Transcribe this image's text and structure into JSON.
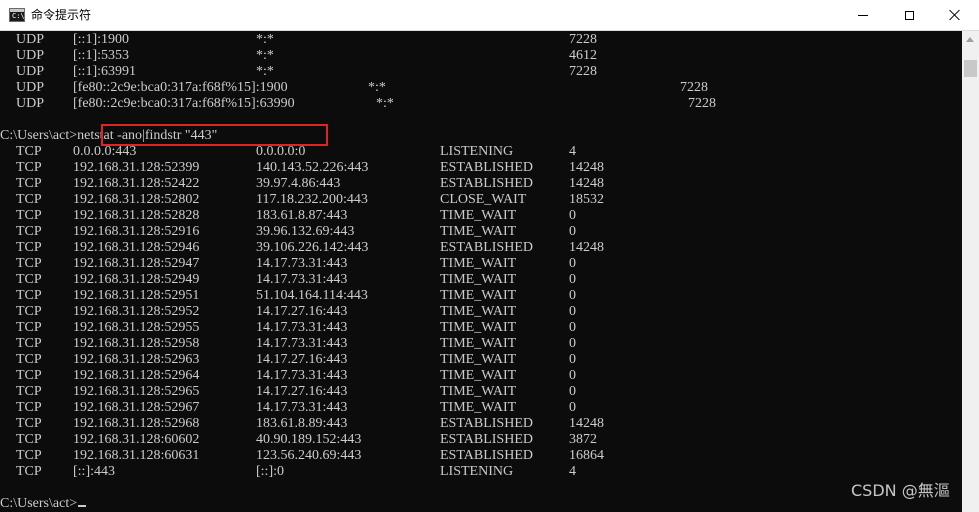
{
  "window": {
    "title": "命令提示符",
    "app_icon_text": "C:\\"
  },
  "top_rows": [
    {
      "proto": "UDP",
      "local": "[::1]:1900",
      "foreign": "*:*",
      "state": "",
      "pid": "7228"
    },
    {
      "proto": "UDP",
      "local": "[::1]:5353",
      "foreign": "*:*",
      "state": "",
      "pid": "4612"
    },
    {
      "proto": "UDP",
      "local": "[::1]:63991",
      "foreign": "*:*",
      "state": "",
      "pid": "7228"
    },
    {
      "proto": "UDP",
      "local": "[fe80::2c9e:bca0:317a:f68f%15]:1900",
      "foreign": "*:*",
      "state": "",
      "pid": "7228"
    },
    {
      "proto": "UDP",
      "local": "[fe80::2c9e:bca0:317a:f68f%15]:63990",
      "foreign": "*:*",
      "state": "",
      "pid": "7228"
    }
  ],
  "command": {
    "prompt": "C:\\Users\\act>",
    "text": "netstat -ano|findstr \"443\""
  },
  "result_rows": [
    {
      "proto": "TCP",
      "local": "0.0.0.0:443",
      "foreign": "0.0.0.0:0",
      "state": "LISTENING",
      "pid": "4"
    },
    {
      "proto": "TCP",
      "local": "192.168.31.128:52399",
      "foreign": "140.143.52.226:443",
      "state": "ESTABLISHED",
      "pid": "14248"
    },
    {
      "proto": "TCP",
      "local": "192.168.31.128:52422",
      "foreign": "39.97.4.86:443",
      "state": "ESTABLISHED",
      "pid": "14248"
    },
    {
      "proto": "TCP",
      "local": "192.168.31.128:52802",
      "foreign": "117.18.232.200:443",
      "state": "CLOSE_WAIT",
      "pid": "18532"
    },
    {
      "proto": "TCP",
      "local": "192.168.31.128:52828",
      "foreign": "183.61.8.87:443",
      "state": "TIME_WAIT",
      "pid": "0"
    },
    {
      "proto": "TCP",
      "local": "192.168.31.128:52916",
      "foreign": "39.96.132.69:443",
      "state": "TIME_WAIT",
      "pid": "0"
    },
    {
      "proto": "TCP",
      "local": "192.168.31.128:52946",
      "foreign": "39.106.226.142:443",
      "state": "ESTABLISHED",
      "pid": "14248"
    },
    {
      "proto": "TCP",
      "local": "192.168.31.128:52947",
      "foreign": "14.17.73.31:443",
      "state": "TIME_WAIT",
      "pid": "0"
    },
    {
      "proto": "TCP",
      "local": "192.168.31.128:52949",
      "foreign": "14.17.73.31:443",
      "state": "TIME_WAIT",
      "pid": "0"
    },
    {
      "proto": "TCP",
      "local": "192.168.31.128:52951",
      "foreign": "51.104.164.114:443",
      "state": "TIME_WAIT",
      "pid": "0"
    },
    {
      "proto": "TCP",
      "local": "192.168.31.128:52952",
      "foreign": "14.17.27.16:443",
      "state": "TIME_WAIT",
      "pid": "0"
    },
    {
      "proto": "TCP",
      "local": "192.168.31.128:52955",
      "foreign": "14.17.73.31:443",
      "state": "TIME_WAIT",
      "pid": "0"
    },
    {
      "proto": "TCP",
      "local": "192.168.31.128:52958",
      "foreign": "14.17.73.31:443",
      "state": "TIME_WAIT",
      "pid": "0"
    },
    {
      "proto": "TCP",
      "local": "192.168.31.128:52963",
      "foreign": "14.17.27.16:443",
      "state": "TIME_WAIT",
      "pid": "0"
    },
    {
      "proto": "TCP",
      "local": "192.168.31.128:52964",
      "foreign": "14.17.73.31:443",
      "state": "TIME_WAIT",
      "pid": "0"
    },
    {
      "proto": "TCP",
      "local": "192.168.31.128:52965",
      "foreign": "14.17.27.16:443",
      "state": "TIME_WAIT",
      "pid": "0"
    },
    {
      "proto": "TCP",
      "local": "192.168.31.128:52967",
      "foreign": "14.17.73.31:443",
      "state": "TIME_WAIT",
      "pid": "0"
    },
    {
      "proto": "TCP",
      "local": "192.168.31.128:52968",
      "foreign": "183.61.8.89:443",
      "state": "ESTABLISHED",
      "pid": "14248"
    },
    {
      "proto": "TCP",
      "local": "192.168.31.128:60602",
      "foreign": "40.90.189.152:443",
      "state": "ESTABLISHED",
      "pid": "3872"
    },
    {
      "proto": "TCP",
      "local": "192.168.31.128:60631",
      "foreign": "123.56.240.69:443",
      "state": "ESTABLISHED",
      "pid": "16864"
    },
    {
      "proto": "TCP",
      "local": "[::]:443",
      "foreign": "[::]:0",
      "state": "LISTENING",
      "pid": "4"
    }
  ],
  "final_prompt": "C:\\Users\\act>",
  "watermark": "CSDN @無漚",
  "colors": {
    "console_bg": "#0c0c0c",
    "console_fg": "#cccccc",
    "highlight_border": "#e02424"
  }
}
